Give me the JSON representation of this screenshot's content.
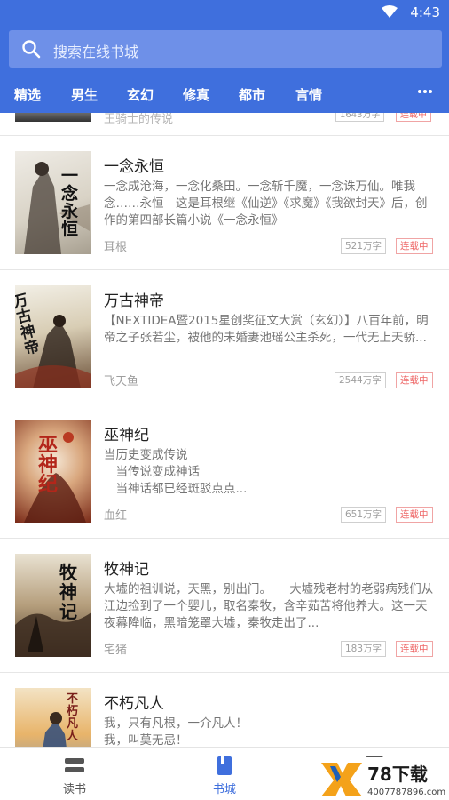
{
  "status": {
    "time": "4:43"
  },
  "search": {
    "placeholder": "搜索在线书城"
  },
  "tabs": [
    "精选",
    "男生",
    "玄幻",
    "修真",
    "都市",
    "言情"
  ],
  "partial_item": {
    "author": "王骑士的传说",
    "words": "1643万字",
    "status": "连载中"
  },
  "books": [
    {
      "title": "一念永恒",
      "cover_text": "一念永恒",
      "description": "一念成沧海，一念化桑田。一念斩千魔，一念诛万仙。唯我念……永恒　这是耳根继《仙逆》《求魔》《我欲封天》后，创作的第四部长篇小说《一念永恒》",
      "author": "耳根",
      "words": "521万字",
      "status": "连载中"
    },
    {
      "title": "万古神帝",
      "cover_text": "万古神帝",
      "description": "【NEXTIDEA暨2015星创奖征文大赏（玄幻）】八百年前，明帝之子张若尘，被他的未婚妻池瑶公主杀死，一代无上天骄...",
      "author": "飞天鱼",
      "words": "2544万字",
      "status": "连载中"
    },
    {
      "title": "巫神纪",
      "cover_text": "巫神纪",
      "description": "当历史变成传说\n　当传说变成神话\n　当神话都已经斑驳点点...",
      "author": "血红",
      "words": "651万字",
      "status": "连载中"
    },
    {
      "title": "牧神记",
      "cover_text": "牧神记",
      "description": "大墟的祖训说，天黑，别出门。　　大墟残老村的老弱病残们从江边捡到了一个婴儿，取名秦牧，含辛茹苦将他养大。这一天夜幕降临，黑暗笼罩大墟，秦牧走出了...",
      "author": "宅猪",
      "words": "183万字",
      "status": "连载中"
    },
    {
      "title": "不朽凡人",
      "cover_text": "不朽凡人",
      "description": "我，只有凡根，一介凡人！\n我，叫莫无忌！",
      "author": "",
      "words": "",
      "status": ""
    }
  ],
  "bottom_nav": [
    {
      "label": "读书",
      "icon": "stack-icon",
      "active": false
    },
    {
      "label": "书城",
      "icon": "book-icon",
      "active": true
    },
    {
      "label": "",
      "icon": "profile-icon",
      "active": false
    }
  ],
  "watermark": {
    "text": "78下载",
    "url": "4007787896.com"
  },
  "colors": {
    "primary": "#3f6fdd",
    "status_red": "#e66666"
  }
}
